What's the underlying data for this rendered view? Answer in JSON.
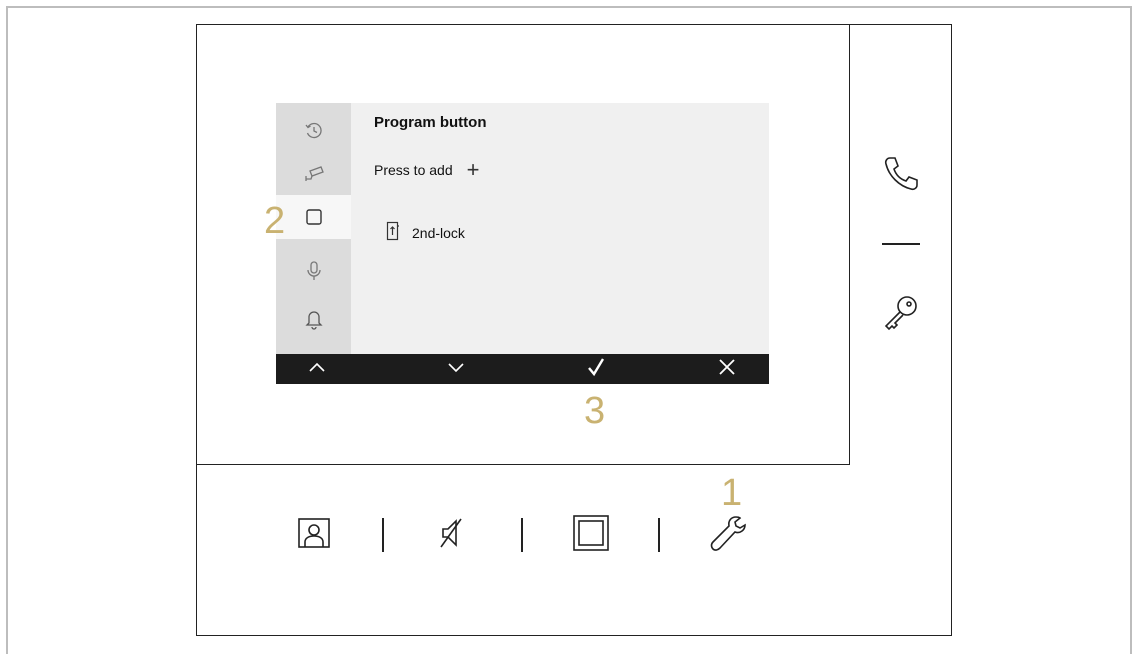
{
  "screen": {
    "title": "Program button",
    "press_to_add": "Press to add",
    "plus_symbol": "+",
    "item_label": "2nd-lock"
  },
  "sidebar": {
    "items": [
      {
        "icon": "history-icon",
        "active": false
      },
      {
        "icon": "camera-icon",
        "active": false
      },
      {
        "icon": "square-button-icon",
        "active": true
      },
      {
        "icon": "microphone-icon",
        "active": false
      },
      {
        "icon": "bell-icon",
        "active": false
      }
    ]
  },
  "bottom_bar": {
    "buttons": [
      {
        "icon": "chevron-up-icon"
      },
      {
        "icon": "chevron-down-icon"
      },
      {
        "icon": "checkmark-icon"
      },
      {
        "icon": "close-icon"
      }
    ]
  },
  "callouts": {
    "one": "1",
    "two": "2",
    "three": "3"
  },
  "hardware": {
    "right_buttons": [
      "phone-icon",
      "key-icon"
    ],
    "bottom_buttons": [
      "contact-icon",
      "mute-icon",
      "square-frame-icon",
      "wrench-icon"
    ]
  },
  "colors": {
    "callout": "#c9b271",
    "lcd_background": "#f0f0f0",
    "sidebar_background": "#dcdcdc",
    "bar_background": "#1c1c1c"
  }
}
